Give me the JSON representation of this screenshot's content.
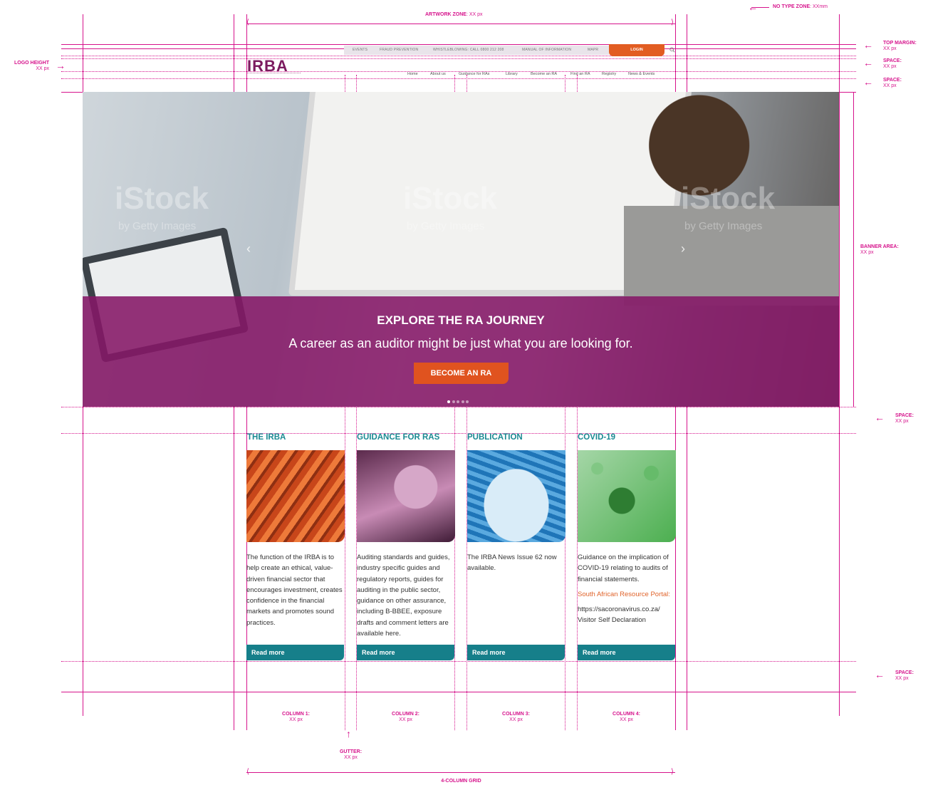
{
  "annotations": {
    "artwork_zone": "ARTWORK ZONE",
    "artwork_zone_value": ": XX px",
    "no_type_zone": "NO TYPE ZONE",
    "no_type_zone_value": ": XXmm",
    "top_margin": "TOP MARGIN:",
    "top_margin_value": "XX px",
    "space": "SPACE:",
    "space_value": "XX px",
    "logo_height": "LOGO HEIGHT",
    "logo_height_value": "XX px",
    "banner_area": "BANNER AREA:",
    "banner_area_value": "XX px",
    "column_1": "COLUMN 1:",
    "column_2": "COLUMN 2:",
    "column_3": "COLUMN 3:",
    "column_4": "COLUMN 4:",
    "column_value": "XX px",
    "gutter": "GUTTER:",
    "gutter_value": "XX px",
    "grid": "4-COLUMN GRID"
  },
  "header": {
    "logo": "IRBA",
    "utility_links": [
      "EVENTS",
      "FRAUD PREVENTION",
      "WHISTLEBLOWING: CALL 0800 212 208",
      "MANUAL OF INFORMATION",
      "MAPR"
    ],
    "login": "LOGIN",
    "nav": [
      "Home",
      "About us",
      "Guidance for RAs",
      "Library",
      "Become an RA",
      "Find an RA",
      "Registry",
      "News & Events"
    ]
  },
  "banner": {
    "title": "EXPLORE THE RA JOURNEY",
    "subtitle": "A career as an auditor might be just what you are looking for.",
    "button": "BECOME AN RA",
    "watermark": "iStock",
    "watermark_sub": "by Getty Images",
    "slides": 5,
    "active_slide": 1
  },
  "columns": [
    {
      "title": "THE IRBA",
      "text": "The function of the IRBA is to help create an ethical, value-driven financial sector that encourages investment, creates confidence in the financial markets and promotes sound practices.",
      "button": "Read more"
    },
    {
      "title": "GUIDANCE FOR RAS",
      "text": "Auditing standards and guides, industry specific guides and regulatory reports, guides for auditing in the public sector, guidance on other assurance, including B-BBEE, exposure drafts and comment letters are available here.",
      "button": "Read more"
    },
    {
      "title": "PUBLICATION",
      "text": "The IRBA News Issue 62 now available.",
      "button": "Read more"
    },
    {
      "title": "COVID-19",
      "text": "Guidance on the implication of COVID-19 relating to audits of financial statements.",
      "link": "South African Resource Portal:",
      "extra": "https://sacoronavirus.co.za/ Visitor Self Declaration",
      "button": "Read more"
    }
  ],
  "colors": {
    "guide": "#d6138c",
    "brand_purple": "#851767",
    "accent_orange": "#e0531f",
    "teal": "#167f8a"
  }
}
